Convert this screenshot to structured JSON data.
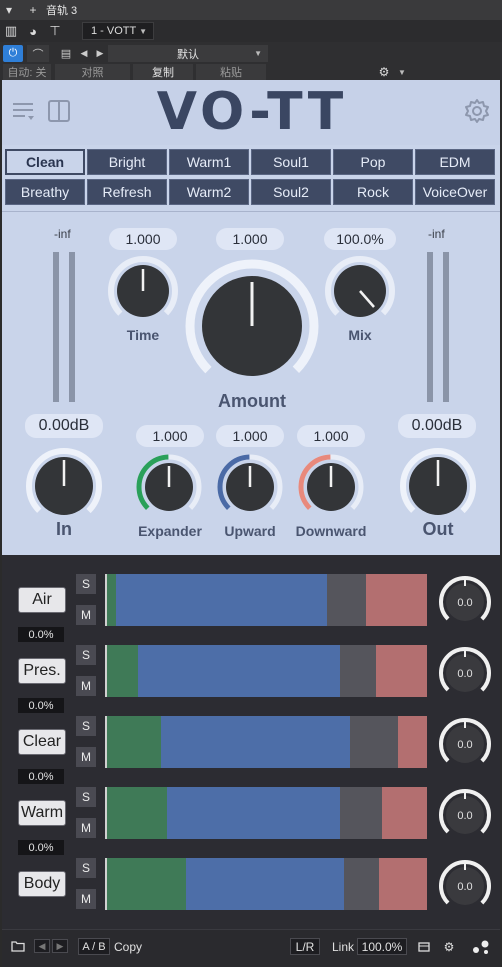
{
  "host": {
    "track_title": "音轨 3",
    "plugin_slot": "1 - VOTT",
    "preset_default": "默认",
    "auto_off": "自动: 关",
    "compare": "对照",
    "copy": "复制",
    "paste": "粘贴"
  },
  "plugin": {
    "logo": "VO-TT"
  },
  "presets": {
    "row1": [
      "Clean",
      "Bright",
      "Warm1",
      "Soul1",
      "Pop",
      "EDM"
    ],
    "row2": [
      "Breathy",
      "Refresh",
      "Warm2",
      "Soul2",
      "Rock",
      "VoiceOver"
    ],
    "active": "Clean"
  },
  "controls": {
    "in_meter_label": "-inf",
    "out_meter_label": "-inf",
    "time_value": "1.000",
    "time_label": "Time",
    "amount_value": "1.000",
    "amount_label": "Amount",
    "mix_value": "100.0%",
    "mix_label": "Mix",
    "in_value": "0.00dB",
    "in_label": "In",
    "out_value": "0.00dB",
    "out_label": "Out",
    "expander_value": "1.000",
    "expander_label": "Expander",
    "upward_value": "1.000",
    "upward_label": "Upward",
    "downward_value": "1.000",
    "downward_label": "Downward"
  },
  "bands": [
    {
      "name": "Air",
      "pct": "0.0%",
      "solo": "S",
      "mute": "M",
      "knob": "0.0",
      "fills": [
        0.03,
        0.66,
        0.12,
        0.19
      ]
    },
    {
      "name": "Pres.",
      "pct": "0.0%",
      "solo": "S",
      "mute": "M",
      "knob": "0.0",
      "fills": [
        0.1,
        0.63,
        0.11,
        0.16
      ]
    },
    {
      "name": "Clear",
      "pct": "0.0%",
      "solo": "S",
      "mute": "M",
      "knob": "0.0",
      "fills": [
        0.17,
        0.59,
        0.15,
        0.09
      ]
    },
    {
      "name": "Warm",
      "pct": "0.0%",
      "solo": "S",
      "mute": "M",
      "knob": "0.0",
      "fills": [
        0.19,
        0.54,
        0.13,
        0.14
      ]
    },
    {
      "name": "Body",
      "pct": "",
      "solo": "S",
      "mute": "M",
      "knob": "0.0",
      "fills": [
        0.25,
        0.49,
        0.11,
        0.15
      ]
    }
  ],
  "footer": {
    "ab": "A / B",
    "copy": "Copy",
    "lr": "L/R",
    "link_label": "Link",
    "link_value": "100.0%"
  }
}
